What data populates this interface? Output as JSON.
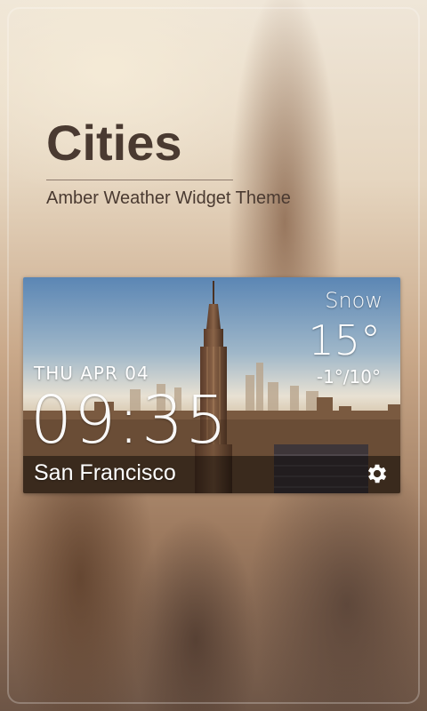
{
  "theme": {
    "title": "Cities",
    "subtitle": "Amber Weather Widget Theme"
  },
  "widget": {
    "condition": "Snow",
    "temperature": "15°",
    "range": "-1°/10°",
    "date": "THU APR 04",
    "time": "09:35",
    "city": "San Francisco",
    "settings_icon": "gear-icon"
  }
}
